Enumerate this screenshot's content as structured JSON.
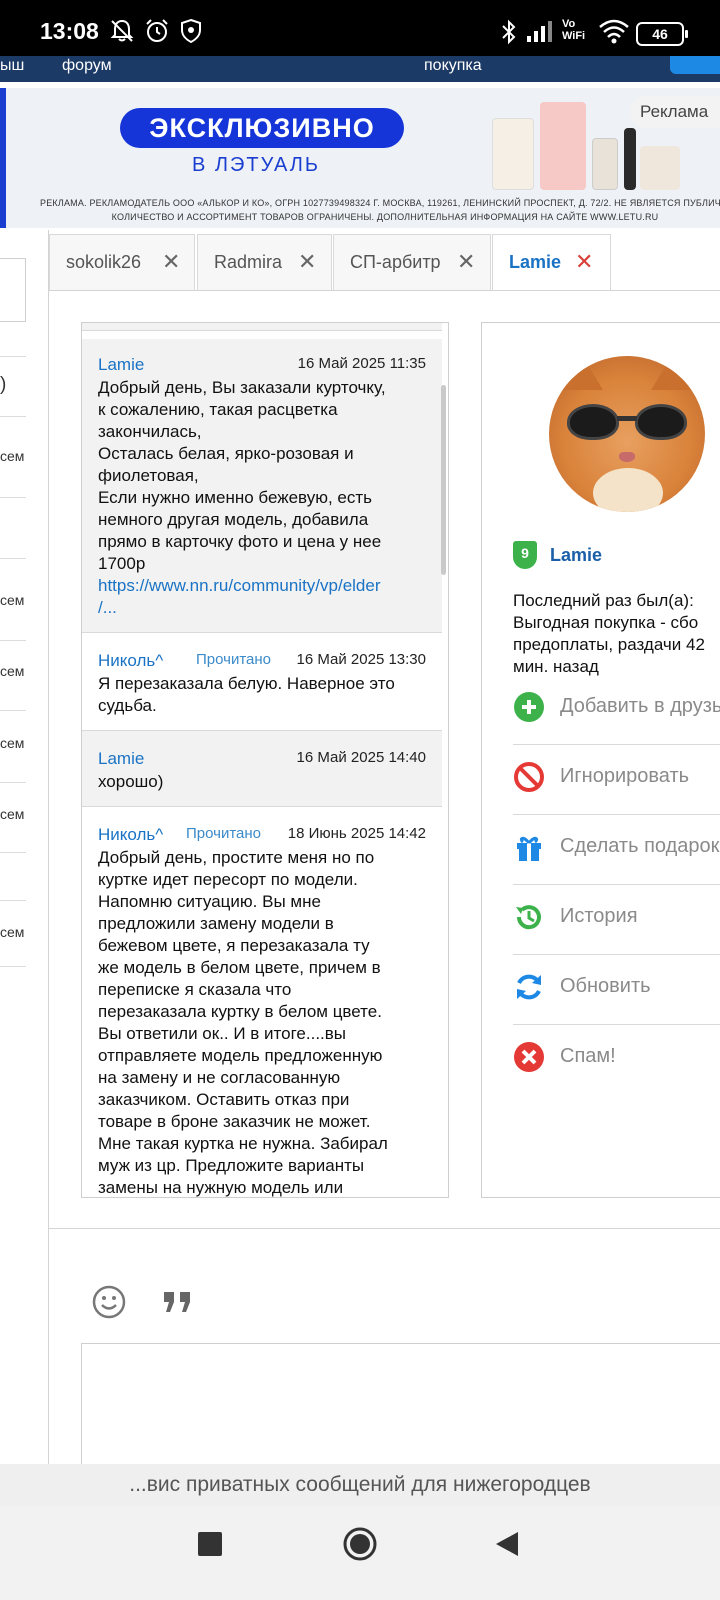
{
  "status_bar": {
    "time": "13:08",
    "battery": "46",
    "vowifi_line1": "Vo",
    "vowifi_line2": "WiFi"
  },
  "nav_strip": {
    "item_left": "ыш",
    "item_forum": "форум",
    "item_purchase": "покупка"
  },
  "ad_banner": {
    "headline": "ЭКСКЛЮЗИВНО",
    "subheadline": "В ЛЭТУАЛЬ",
    "legal_line1": "РЕКЛАМА. РЕКЛАМОДАТЕЛЬ ООО «АЛЬКОР И КО», ОГРН 1027739498324 Г. МОСКВА, 119261, ЛЕНИНСКИЙ ПРОСПЕКТ, Д. 72/2. НЕ ЯВЛЯЕТСЯ ПУБЛИЧНОЙ ОФЕРТОЙ.",
    "legal_line2": "КОЛИЧЕСТВО И АССОРТИМЕНТ ТОВАРОВ ОГРАНИЧЕНЫ. ДОПОЛНИТЕЛЬНАЯ ИНФОРМАЦИЯ НА САЙТЕ WWW.LETU.RU",
    "label": "Реклама"
  },
  "left_column": {
    "fragments": [
      ")",
      "сем",
      "сем",
      "сем",
      "сем",
      "сем",
      "сем"
    ]
  },
  "tabs": [
    {
      "label": "sokolik26",
      "close": "✕",
      "active": false
    },
    {
      "label": "Radmira",
      "close": "✕",
      "active": false
    },
    {
      "label": "СП-арбитр",
      "close": "✕",
      "active": false
    },
    {
      "label": "Lamie",
      "close": "✕",
      "active": true
    }
  ],
  "messages": [
    {
      "author": "Lamie",
      "read_status": "",
      "date": "16 Май 2025 11:35",
      "body": "Добрый день, Вы заказали курточку,\nк сожалению, такая расцветка\nзакончилась,\nОсталась белая, ярко-розовая и\nфиолетовая,\nЕсли нужно именно бежевую, есть\nнемного другая модель, добавила\nпрямо в карточку фото и цена у нее\n1700р",
      "link": "https://www.nn.ru/community/vp/elder\n/..."
    },
    {
      "author": "Николь^",
      "read_status": "Прочитано",
      "date": "16 Май 2025 13:30",
      "body": "Я перезаказала белую. Наверное это\nсудьба.",
      "link": ""
    },
    {
      "author": "Lamie",
      "read_status": "",
      "date": "16 Май 2025 14:40",
      "body": "хорошо)",
      "link": ""
    },
    {
      "author": "Николь^",
      "read_status": "Прочитано",
      "date": "18 Июнь 2025 14:42",
      "body": "Добрый день, простите меня но по\nкуртке идет пересорт по модели.\nНапомню ситуацию. Вы мне\nпредложили замену модели в\nбежевом цвете, я перезаказала ту\nже модель в белом цвете, причем в\nпереписке я сказала что\nперезаказала куртку в белом цвете.\nВы ответили ок.. И в итоге....вы\nотправляете модель предложенную\nна замену и не согласованную\nзаказчиком. Оставить отказ при\nтоваре в броне заказчик не может.\nМне такая куртка не нужна. Забирал\nмуж из цр. Предложите варианты\nзамены на нужную модель или",
      "link": ""
    }
  ],
  "profile": {
    "level": "9",
    "name": "Lamie",
    "last_seen": "Последний раз был(а):\nВыгодная покупка - сбо\nпредоплаты, раздачи 42\nмин. назад",
    "actions": [
      {
        "label": "Добавить в друзья",
        "icon": "add-friend-icon",
        "color": "#3db24a"
      },
      {
        "label": "Игнорировать",
        "icon": "block-icon",
        "color": "#e53935"
      },
      {
        "label": "Сделать подарок",
        "icon": "gift-icon",
        "color": "#1e88e5"
      },
      {
        "label": "История",
        "icon": "history-icon",
        "color": "#3db24a"
      },
      {
        "label": "Обновить",
        "icon": "refresh-icon",
        "color": "#1e88e5"
      },
      {
        "label": "Спам!",
        "icon": "spam-icon",
        "color": "#e53935"
      }
    ]
  },
  "composer": {
    "emoji_icon": "smiley-icon",
    "quote_icon": "quote-icon"
  },
  "url_bar": {
    "text": "...вис приватных сообщений для нижегородцев"
  }
}
